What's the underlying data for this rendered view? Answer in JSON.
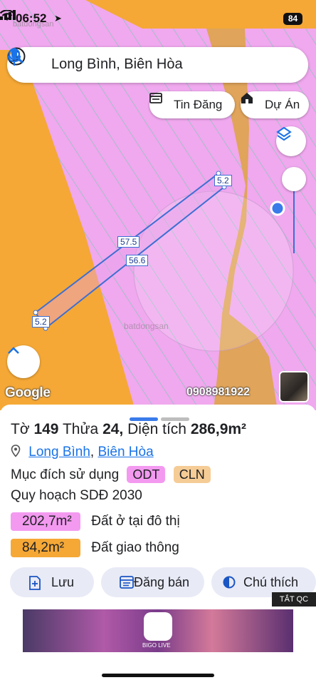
{
  "status_bar": {
    "time": "06:52",
    "battery": "84"
  },
  "watermark": "batdongsan",
  "search": {
    "query": "Long Bình, Biên Hòa"
  },
  "chips": {
    "tin_dang": "Tin Đăng",
    "du_an": "Dự Án"
  },
  "map": {
    "google_label": "Google",
    "phone_watermark": "0908981922",
    "dimensions": {
      "top_side": "5.2",
      "long_side_a": "57.5",
      "long_side_b": "56.6",
      "bottom_side": "5.2"
    },
    "colors": {
      "residential": "#f0a8ee",
      "road": "#f5a836",
      "parcel_line": "#3d6fd3"
    }
  },
  "sheet": {
    "title": {
      "prefix": "Tờ",
      "to": "149",
      "thua_label": "Thửa",
      "thua": "24,",
      "dien_tich_label": "Diện tích",
      "dien_tich": "286,9m²"
    },
    "address": {
      "ward": "Long Bình",
      "sep": ",",
      "district": "Biên Hòa"
    },
    "purpose": {
      "label": "Mục đích sử dụng",
      "tags": [
        "ODT",
        "CLN"
      ]
    },
    "plan": "Quy hoạch SDĐ 2030",
    "areas": [
      {
        "value": "202,7m²",
        "label": "Đất ở tại đô thị",
        "color": "#f39af0"
      },
      {
        "value": "84,2m²",
        "label": "Đất giao thông",
        "color": "#f5a836"
      }
    ],
    "buttons": {
      "save": "Lưu",
      "sell": "Đăng bán",
      "legend": "Chú thích"
    },
    "ad_close": "TẮT QC",
    "ad_brand": "BIGO LIVE"
  }
}
